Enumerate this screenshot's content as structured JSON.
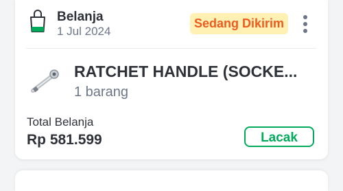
{
  "order": {
    "category": "Belanja",
    "date": "1 Jul 2024",
    "status": "Sedang Dikirim",
    "product": {
      "name": "RATCHET HANDLE (SOCKE...",
      "quantity": "1 barang"
    },
    "total_label": "Total Belanja",
    "total_value": "Rp 581.599",
    "track_label": "Lacak"
  },
  "icons": {
    "bag": "shopping-bag-icon",
    "more": "more-vertical-icon"
  },
  "colors": {
    "accent": "#00aa5b",
    "status_bg": "#fff0b3",
    "status_text": "#ef5b1e",
    "text_primary": "#2e3137",
    "text_secondary": "#6d7588"
  }
}
